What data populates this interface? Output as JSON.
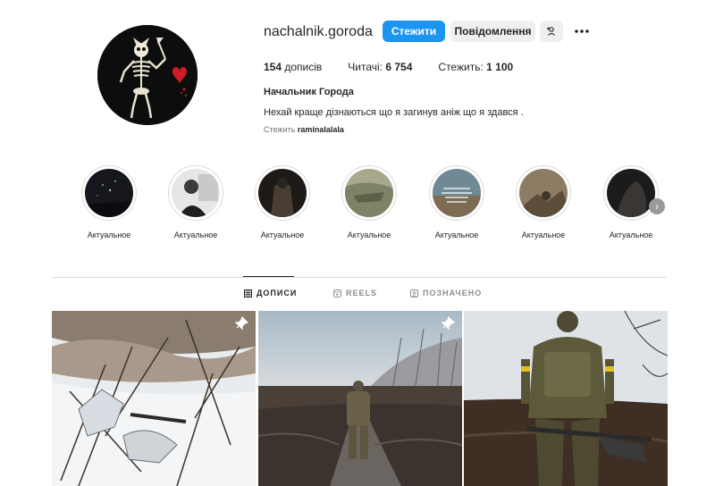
{
  "profile": {
    "username": "nachalnik.goroda",
    "follow_label": "Стежити",
    "message_label": "Повідомлення",
    "posts_count": "154",
    "posts_label": "дописів",
    "followers_label": "Читачі:",
    "followers_count": "6 754",
    "following_label": "Стежить:",
    "following_count": "1 100",
    "full_name": "Начальник Города",
    "bio": "Нехай краще дізнаються що я загинув аніж що я здався .",
    "followed_by_label": "Стежить",
    "followed_by_user": "raminalalala"
  },
  "highlights": [
    {
      "label": "Актуальное"
    },
    {
      "label": "Актуальное"
    },
    {
      "label": "Актуальное"
    },
    {
      "label": "Актуальное"
    },
    {
      "label": "Актуальное"
    },
    {
      "label": "Актуальное"
    },
    {
      "label": "Актуальное"
    }
  ],
  "tabs": [
    {
      "label": "ДОПИСИ",
      "icon": "grid-icon",
      "active": true
    },
    {
      "label": "REELS",
      "icon": "reels-icon",
      "active": false
    },
    {
      "label": "ПОЗНАЧЕНО",
      "icon": "tagged-icon",
      "active": false
    }
  ],
  "posts": [
    {
      "pinned": true,
      "scene": "soldiers in snow camouflage among bare branches"
    },
    {
      "pinned": true,
      "scene": "soldier standing on a muddy field road"
    },
    {
      "pinned": false,
      "scene": "soldier with a machine gun on a plowed field"
    }
  ],
  "colors": {
    "accent": "#1b95f0",
    "secondary_button": "#efefef",
    "text": "#262626",
    "muted": "#737373",
    "divider": "#dbdbdb"
  }
}
